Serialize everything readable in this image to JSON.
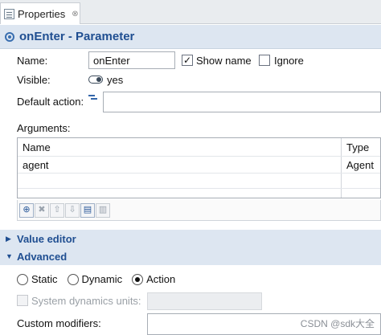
{
  "tab": {
    "label": "Properties",
    "close_glyph": "⊗"
  },
  "header": {
    "title": "onEnter - Parameter"
  },
  "form": {
    "name_label": "Name:",
    "name_value": "onEnter",
    "show_name_label": "Show name",
    "show_name_checked": true,
    "ignore_label": "Ignore",
    "ignore_checked": false,
    "visible_label": "Visible:",
    "visible_value": "yes",
    "default_action_label": "Default action:",
    "default_action_value": "",
    "arguments_label": "Arguments:"
  },
  "arguments_table": {
    "columns": [
      "Name",
      "Type"
    ],
    "rows": [
      {
        "name": "agent",
        "type": "Agent"
      }
    ]
  },
  "table_toolbar": {
    "buttons": [
      {
        "icon": "add-row-icon",
        "glyph": "⊕",
        "enabled": true
      },
      {
        "icon": "delete-row-icon",
        "glyph": "✖",
        "enabled": false
      },
      {
        "icon": "move-up-icon",
        "glyph": "⇧",
        "enabled": false
      },
      {
        "icon": "move-down-icon",
        "glyph": "⇩",
        "enabled": false
      },
      {
        "icon": "paste-icon",
        "glyph": "▤",
        "enabled": true
      },
      {
        "icon": "copy-icon",
        "glyph": "▥",
        "enabled": false
      }
    ]
  },
  "sections": {
    "value_editor": {
      "title": "Value editor",
      "expanded": false
    },
    "advanced": {
      "title": "Advanced",
      "expanded": true
    }
  },
  "advanced": {
    "mode_options": [
      "Static",
      "Dynamic",
      "Action"
    ],
    "mode_selected": "Action",
    "system_dynamics_label": "System dynamics units:",
    "custom_modifiers_label": "Custom modifiers:"
  },
  "watermark": "CSDN @sdk大全",
  "colors": {
    "accent": "#1f4e91",
    "section_bg": "#dde6f1"
  }
}
